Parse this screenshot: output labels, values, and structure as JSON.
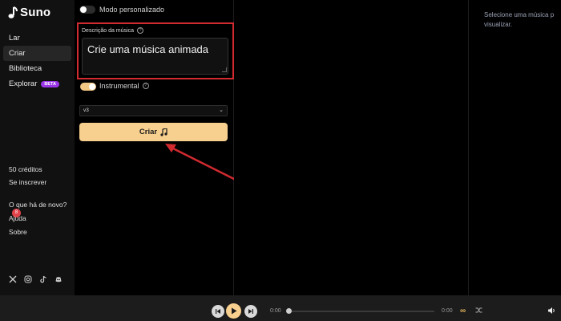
{
  "app": {
    "name": "Suno"
  },
  "sidebar": {
    "nav": [
      {
        "label": "Lar"
      },
      {
        "label": "Criar"
      },
      {
        "label": "Biblioteca"
      },
      {
        "label": "Explorar",
        "badge": "BETA"
      }
    ],
    "credits": "50 créditos",
    "subscribe": "Se inscrever",
    "whats_new": "O que há de novo?",
    "whats_new_count": "8",
    "help": "Ajuda",
    "about": "Sobre",
    "social_icons": [
      "x-icon",
      "instagram-icon",
      "tiktok-icon",
      "discord-icon"
    ]
  },
  "create": {
    "custom_mode_label": "Modo personalizado",
    "custom_mode_on": false,
    "description_label": "Descrição da música",
    "description_value": "Crie uma música animada",
    "instrumental_label": "Instrumental",
    "instrumental_on": true,
    "model_version": "v3",
    "create_button": "Criar"
  },
  "right_panel": {
    "line1": "Selecione uma música p",
    "line2": "visualizar."
  },
  "player": {
    "current_time": "0:00",
    "end_time": "0:00",
    "progress": 0
  },
  "colors": {
    "accent": "#f7cf8e",
    "highlight": "#d12a2f",
    "beta_badge": "#9b35e8"
  }
}
